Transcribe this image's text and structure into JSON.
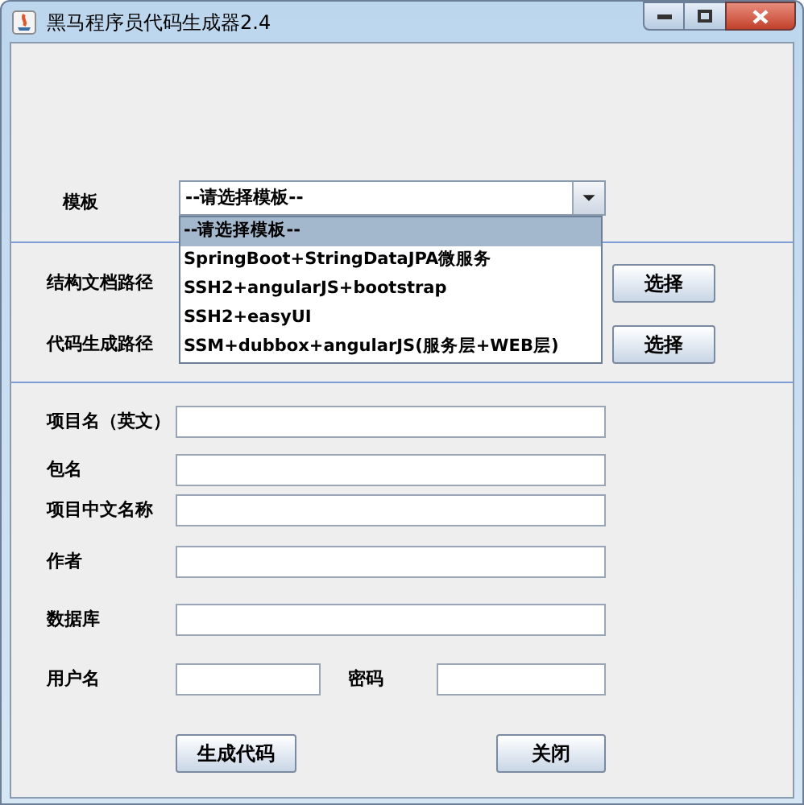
{
  "window": {
    "title": "黑马程序员代码生成器2.4"
  },
  "template": {
    "label": "模板",
    "value": "--请选择模板--",
    "expanded": true,
    "options": [
      {
        "label": "--请选择模板--",
        "selected": true
      },
      {
        "label": "SpringBoot+StringDataJPA微服务",
        "selected": false
      },
      {
        "label": "SSH2+angularJS+bootstrap",
        "selected": false
      },
      {
        "label": "SSH2+easyUI",
        "selected": false
      },
      {
        "label": "SSM+dubbox+angularJS(服务层+WEB层)",
        "selected": false
      }
    ]
  },
  "paths": [
    {
      "label": "结构文档路径",
      "button": "选择"
    },
    {
      "label": "代码生成路径",
      "button": "选择"
    }
  ],
  "fields": [
    {
      "label": "项目名（英文）"
    },
    {
      "label": "包名"
    },
    {
      "label": "项目中文名称"
    },
    {
      "label": "作者"
    },
    {
      "label": "数据库"
    }
  ],
  "credentials": [
    {
      "label": "用户名"
    },
    {
      "label": "密码"
    }
  ],
  "buttons": [
    "生成代码",
    "关闭"
  ]
}
